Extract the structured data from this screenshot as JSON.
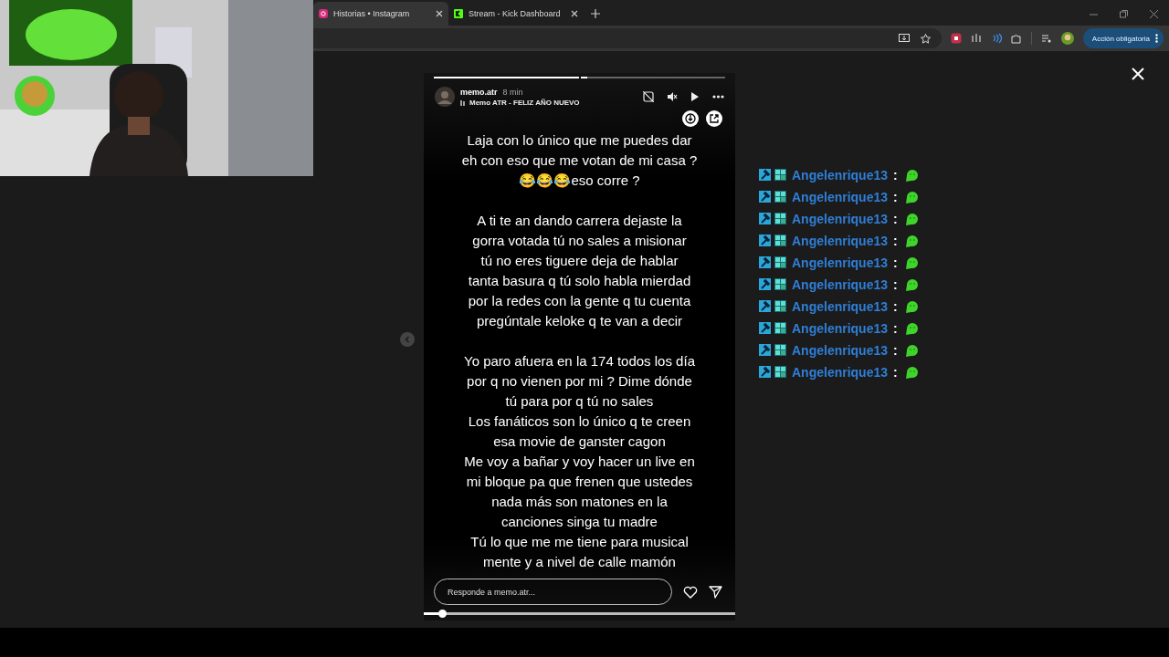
{
  "browser": {
    "tabs": [
      {
        "label": "Historias • Instagram",
        "selected": true,
        "kind": "instagram"
      },
      {
        "label": "Stream - Kick Dashboard",
        "selected": false,
        "kind": "kick"
      }
    ],
    "toolbar": {
      "action_button": "Acción obligatoria"
    }
  },
  "story": {
    "segments": [
      {
        "level": 1
      },
      {
        "level": 0.05
      }
    ],
    "username": "memo.atr",
    "time": "8 min",
    "song": "Memo ATR - FELIZ AÑO NUEVO",
    "stanzas": [
      [
        "Laja con lo único que me puedes dar",
        "eh con eso que me votan de mi casa ?",
        "😂😂😂eso corre ?"
      ],
      [
        "A ti te an dando carrera dejaste la",
        "gorra votada tú no sales a misionar",
        "tú no eres tiguere deja de hablar",
        "tanta basura q tú solo habla mierdad",
        "por la redes con la gente q tu cuenta",
        "pregúntale keloke q te van a decir"
      ],
      [
        "Yo paro afuera en la 174 todos los día",
        "por q no vienen por mi ? Dime dónde",
        "tú para por q tú no sales",
        "Los fanáticos son lo único q te creen",
        "esa movie de ganster cagon",
        "Me voy a bañar y voy hacer un live en",
        "mi bloque pa que frenen que ustedes",
        "nada más son matones en la",
        "canciones singa tu madre",
        "Tú lo que me me tiene para musical",
        "mente y a nivel de calle mamón"
      ]
    ],
    "reply": {
      "placeholder": "Responde a memo.atr..."
    },
    "scrubber": {
      "level": 0.06
    }
  },
  "chat_messages": [
    {
      "username": "Angelenrique13",
      "separator": ":"
    },
    {
      "username": "Angelenrique13",
      "separator": ":"
    },
    {
      "username": "Angelenrique13",
      "separator": ":"
    },
    {
      "username": "Angelenrique13",
      "separator": ":"
    },
    {
      "username": "Angelenrique13",
      "separator": ":"
    },
    {
      "username": "Angelenrique13",
      "separator": ":"
    },
    {
      "username": "Angelenrique13",
      "separator": ":"
    },
    {
      "username": "Angelenrique13",
      "separator": ":"
    },
    {
      "username": "Angelenrique13",
      "separator": ":"
    },
    {
      "username": "Angelenrique13",
      "separator": ":"
    }
  ]
}
